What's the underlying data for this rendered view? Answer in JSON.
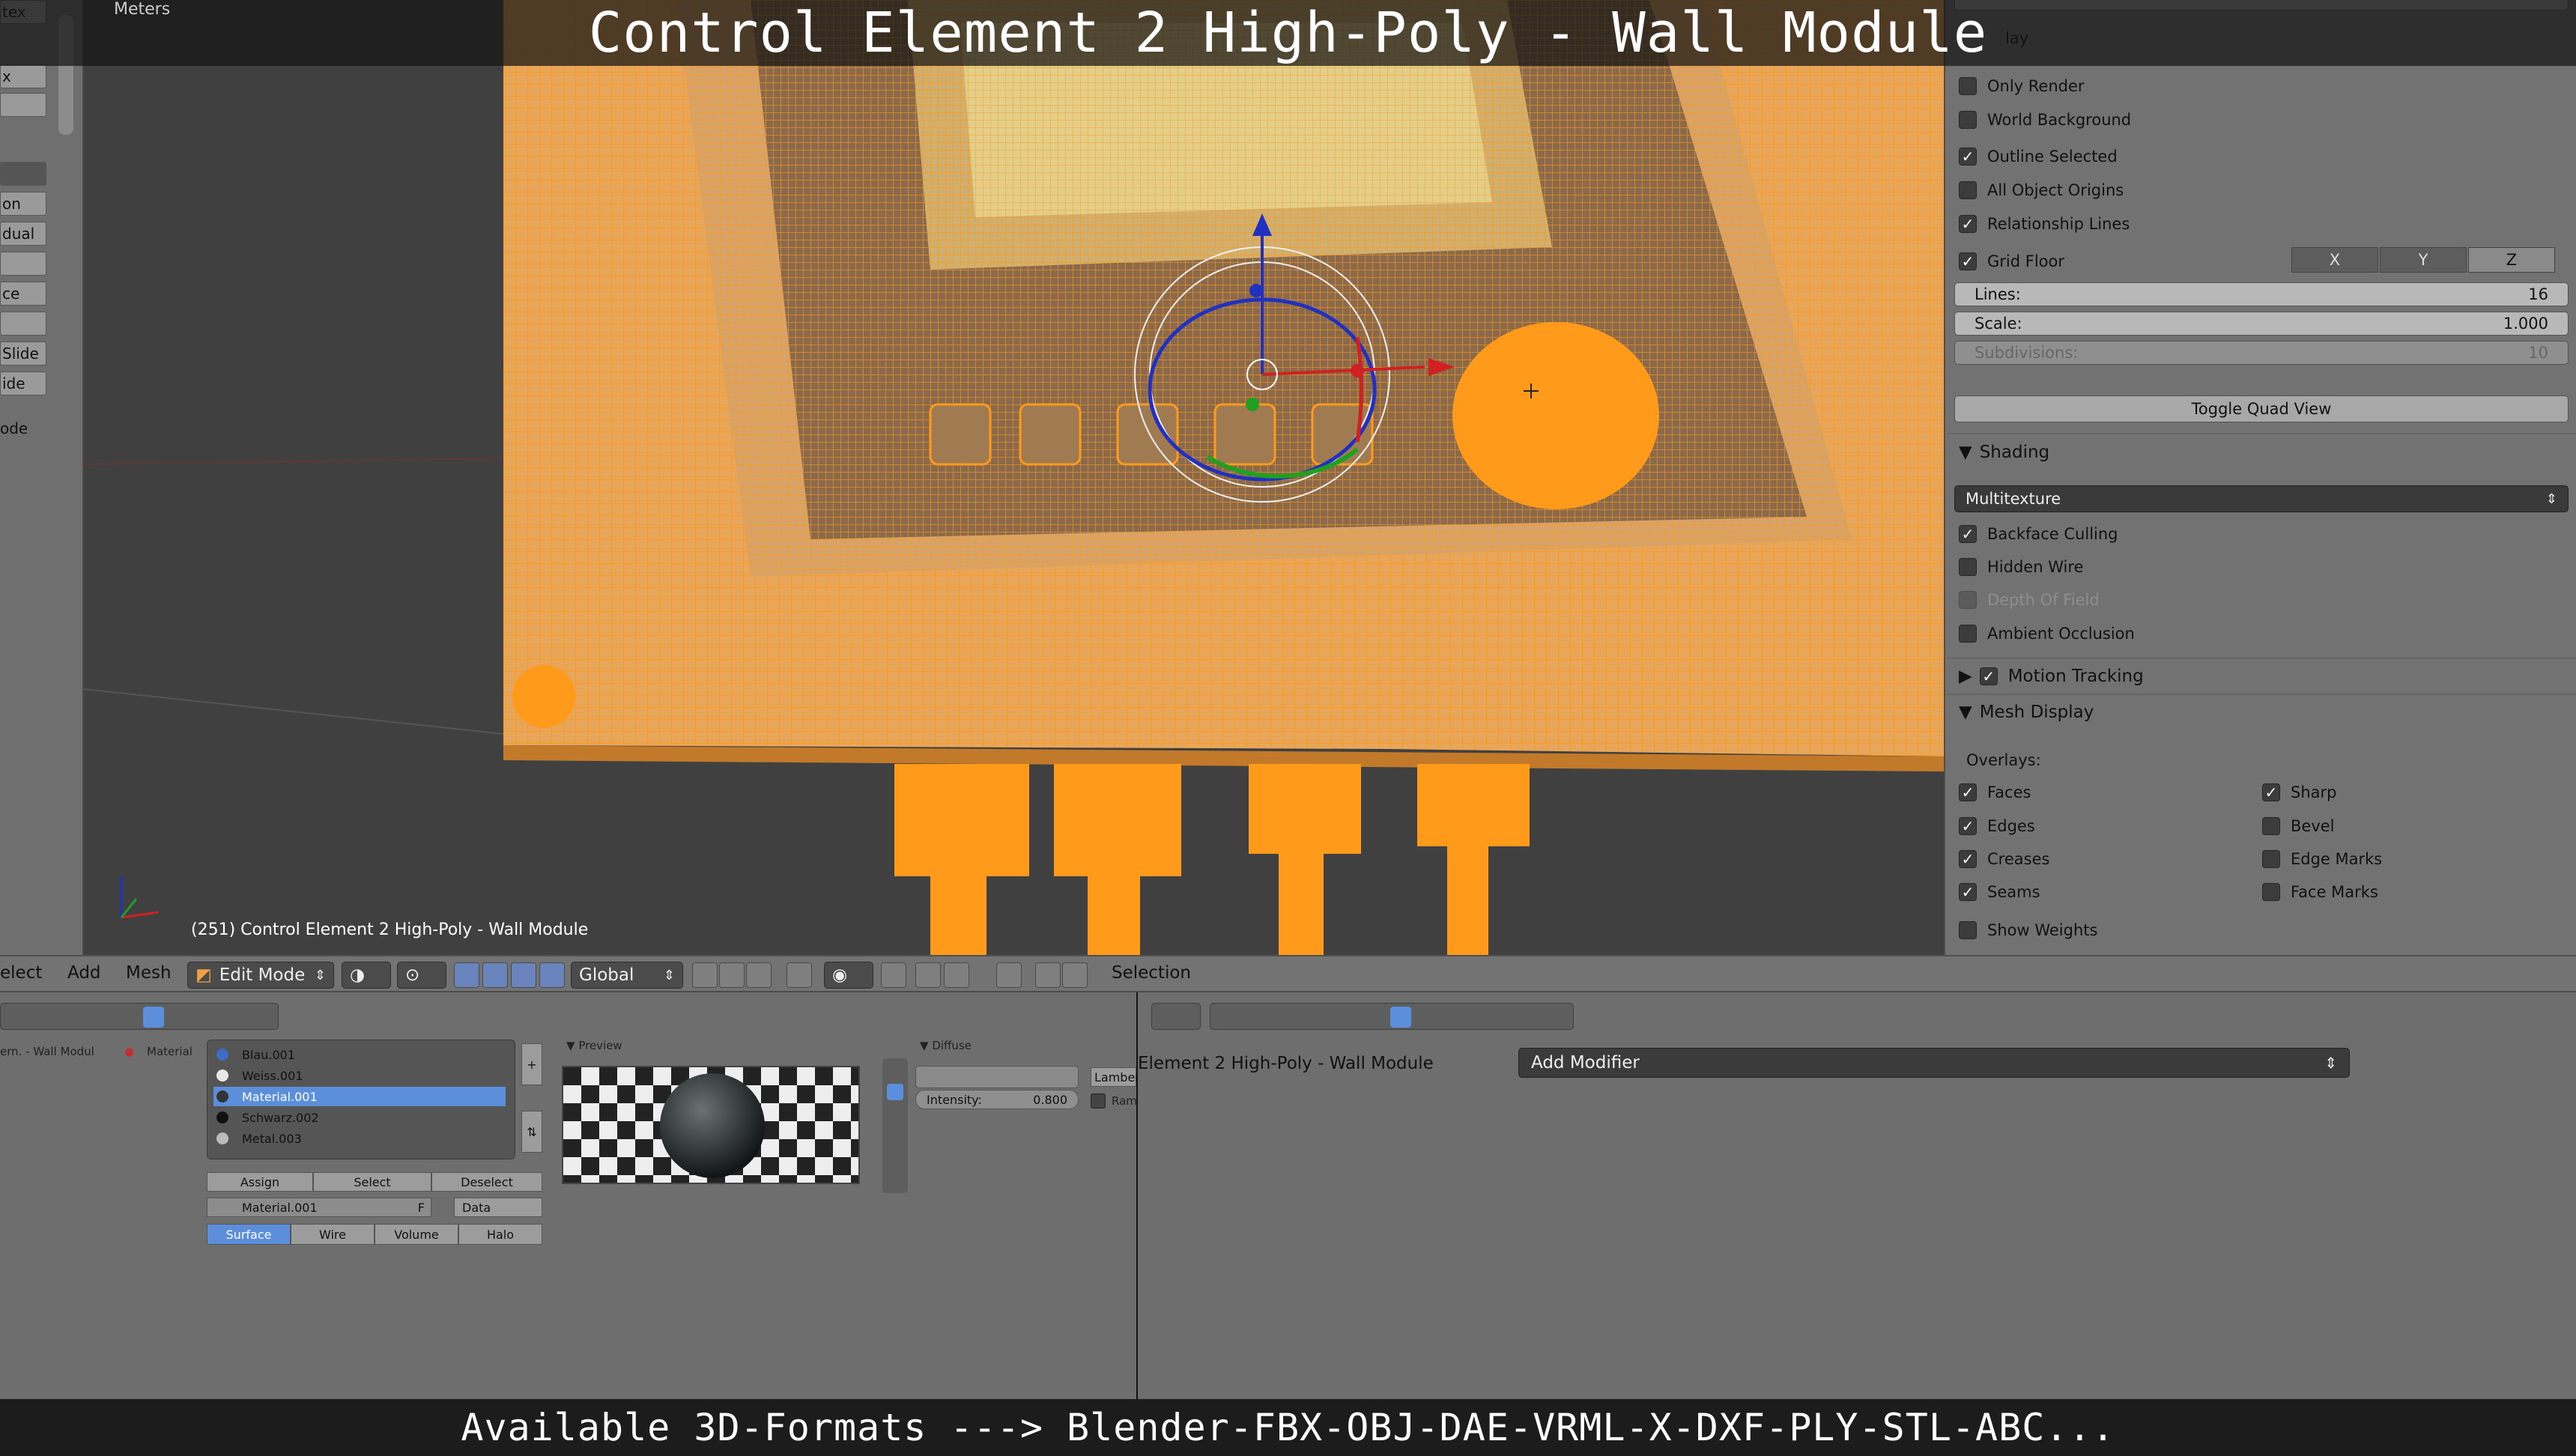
{
  "window": {
    "title_overlay": "Control Element 2 High-Poly - Wall Module",
    "formats_banner": "Available 3D-Formats ---> Blender-FBX-OBJ-DAE-VRML-X-DXF-PLY-STL-ABC..."
  },
  "left_shelf": {
    "items": [
      "tex",
      "x",
      "on",
      "dual",
      "ce",
      "Slide",
      "ide",
      "ode"
    ]
  },
  "viewport": {
    "unit_label": "Meters",
    "object_label": "(251) Control Element 2 High-Poly - Wall Module",
    "mesh_color": "#ff9a1a",
    "background_color": "#404040"
  },
  "properties": {
    "display_header": "lay",
    "only_render": {
      "label": "Only Render",
      "checked": false
    },
    "world_background": {
      "label": "World Background",
      "checked": false
    },
    "outline_selected": {
      "label": "Outline Selected",
      "checked": true
    },
    "all_object_origins": {
      "label": "All Object Origins",
      "checked": false
    },
    "relationship_lines": {
      "label": "Relationship Lines",
      "checked": true
    },
    "grid_floor": {
      "label": "Grid Floor",
      "checked": true
    },
    "axes": {
      "x": "X",
      "y": "Y",
      "z": "Z"
    },
    "lines": {
      "label": "Lines:",
      "value": "16"
    },
    "scale": {
      "label": "Scale:",
      "value": "1.000"
    },
    "subdivisions": {
      "label": "Subdivisions:",
      "value": "10"
    },
    "toggle_quad": "Toggle Quad View",
    "shading": {
      "header": "Shading",
      "mode": "Multitexture",
      "backface_culling": {
        "label": "Backface Culling",
        "checked": true
      },
      "hidden_wire": {
        "label": "Hidden Wire",
        "checked": false
      },
      "depth_of_field": {
        "label": "Depth Of Field",
        "checked": false
      },
      "ambient_occlusion": {
        "label": "Ambient Occlusion",
        "checked": false
      }
    },
    "motion_tracking": {
      "label": "Motion Tracking",
      "checked": true
    },
    "mesh_display": {
      "header": "Mesh Display",
      "overlays_label": "Overlays:",
      "faces": {
        "label": "Faces",
        "checked": true
      },
      "edges": {
        "label": "Edges",
        "checked": true
      },
      "creases": {
        "label": "Creases",
        "checked": true
      },
      "seams": {
        "label": "Seams",
        "checked": true
      },
      "show_weights": {
        "label": "Show Weights",
        "checked": false
      },
      "sharp": {
        "label": "Sharp",
        "checked": true
      },
      "bevel": {
        "label": "Bevel",
        "checked": false
      },
      "edge_marks": {
        "label": "Edge Marks",
        "checked": false
      },
      "face_marks": {
        "label": "Face Marks",
        "checked": false
      }
    }
  },
  "header_bar": {
    "menu_select": "elect",
    "menu_add": "Add",
    "menu_mesh": "Mesh",
    "mode": "Edit Mode",
    "orientation": "Global",
    "selection_label": "Selection"
  },
  "material_panel": {
    "breadcrumb": "ern. - Wall Modul",
    "breadcrumb_material": "Material",
    "slots": [
      {
        "name": "Blau.001",
        "color": "#3b6fc4",
        "selected": false
      },
      {
        "name": "Weiss.001",
        "color": "#e8e8e8",
        "selected": false
      },
      {
        "name": "Material.001",
        "color": "#333333",
        "selected": true
      },
      {
        "name": "Schwarz.002",
        "color": "#111111",
        "selected": false
      },
      {
        "name": "Metal.003",
        "color": "#bbbbbb",
        "selected": false
      }
    ],
    "assign": "Assign",
    "select": "Select",
    "deselect": "Deselect",
    "material_name": "Material.001",
    "material_f": "F",
    "data_link": "Data",
    "tabs": [
      "Surface",
      "Wire",
      "Volume",
      "Halo"
    ],
    "preview_header": "Preview",
    "diffuse_header": "Diffuse",
    "diffuse_shader": "Lambert",
    "ramp_label": "Ram",
    "intensity_label": "Intensity:",
    "intensity_value": "0.800"
  },
  "modifier_panel": {
    "object_name": "Element 2 High-Poly - Wall Module",
    "add_modifier": "Add Modifier"
  }
}
